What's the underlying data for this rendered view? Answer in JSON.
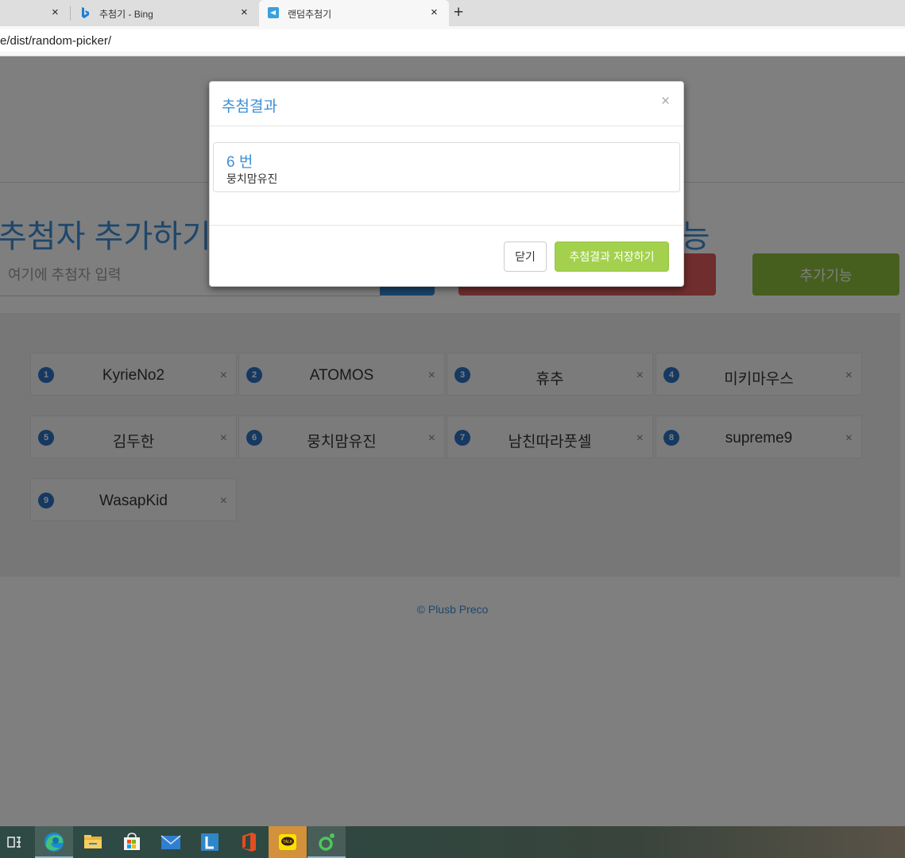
{
  "browser": {
    "tabs": [
      {
        "label": "",
        "has_close": true
      },
      {
        "label": "추첨기 - Bing",
        "has_close": true,
        "icon": "bing-icon"
      },
      {
        "label": "랜덤추첨기",
        "has_close": true,
        "icon": "picker-favicon",
        "active": true
      }
    ],
    "new_tab_label": "+",
    "close_glyph": "×",
    "address": "e/dist/random-picker/"
  },
  "page": {
    "add_section_title": "추첨자 추가하기",
    "extra_section_title": "기능",
    "input_placeholder": "여기에 추첨자 입력",
    "extra_button_label": "추가기능",
    "participants": [
      {
        "num": "1",
        "name": "KyrieNo2"
      },
      {
        "num": "2",
        "name": "ATOMOS"
      },
      {
        "num": "3",
        "name": "휴추"
      },
      {
        "num": "4",
        "name": "미키마우스"
      },
      {
        "num": "5",
        "name": "김두한"
      },
      {
        "num": "6",
        "name": "뭉치맘유진"
      },
      {
        "num": "7",
        "name": "남친따라풋셀"
      },
      {
        "num": "8",
        "name": "supreme9"
      },
      {
        "num": "9",
        "name": "WasapKid"
      }
    ],
    "remove_glyph": "×",
    "footer": "© Plusb Preco"
  },
  "modal": {
    "title": "추첨결과",
    "close_glyph": "×",
    "result_number": "6 번",
    "result_name": "뭉치맘유진",
    "close_button": "닫기",
    "save_button": "추첨결과 저장하기"
  },
  "taskbar": {
    "items": [
      "task-view-icon",
      "edge-icon",
      "file-explorer-icon",
      "store-icon",
      "mail-icon",
      "l-app-icon",
      "office-icon",
      "kakaotalk-icon",
      "green-app-icon"
    ]
  },
  "colors": {
    "accent": "#3f8fd6",
    "danger": "#e05b5b",
    "success": "#8cbf3d",
    "save": "#a3d14e"
  }
}
